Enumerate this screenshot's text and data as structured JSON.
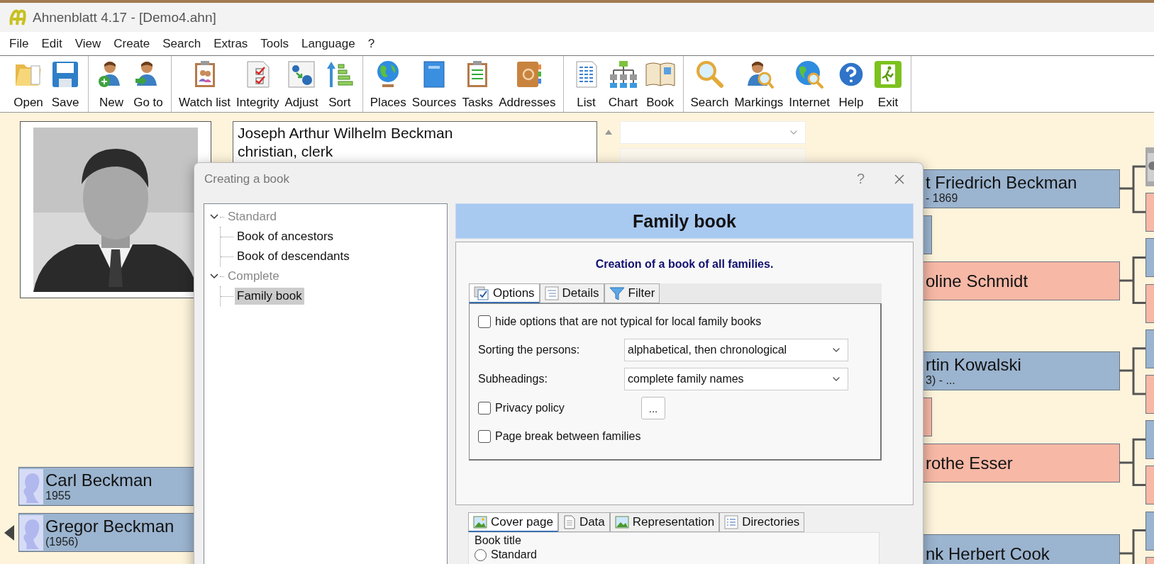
{
  "window": {
    "title": "Ahnenblatt 4.17 - [Demo4.ahn]"
  },
  "menu": [
    "File",
    "Edit",
    "View",
    "Create",
    "Search",
    "Extras",
    "Tools",
    "Language",
    "?"
  ],
  "toolbar": [
    [
      {
        "label": "Open"
      },
      {
        "label": "Save"
      }
    ],
    [
      {
        "label": "New"
      },
      {
        "label": "Go to"
      }
    ],
    [
      {
        "label": "Watch list"
      },
      {
        "label": "Integrity"
      },
      {
        "label": "Adjust"
      },
      {
        "label": "Sort"
      }
    ],
    [
      {
        "label": "Places"
      },
      {
        "label": "Sources"
      },
      {
        "label": "Tasks"
      },
      {
        "label": "Addresses"
      }
    ],
    [
      {
        "label": "List"
      },
      {
        "label": "Chart"
      },
      {
        "label": "Book"
      }
    ],
    [
      {
        "label": "Search"
      },
      {
        "label": "Markings"
      },
      {
        "label": "Internet"
      },
      {
        "label": "Help"
      },
      {
        "label": "Exit"
      }
    ]
  ],
  "person": {
    "name": "Joseph Arthur Wilhelm Beckman",
    "occupation": "christian, clerk"
  },
  "descendants": [
    {
      "name": "Carl Beckman",
      "dates": "1955"
    },
    {
      "name": "Gregor Beckman",
      "dates": "(1956)"
    }
  ],
  "chart_nodes": [
    {
      "name": "t Friedrich Beckman",
      "dates": "- 1869",
      "color": "#9bb4cf"
    },
    {
      "color": "#9bb4cf"
    },
    {
      "name": "oline Schmidt",
      "color": "#f7b8a6"
    },
    {
      "name": "rtin Kowalski",
      "dates": "3) - ...",
      "color": "#9bb4cf"
    },
    {
      "color": "#f7b8a6"
    },
    {
      "name": "rothe Esser",
      "color": "#f7b8a6"
    },
    {
      "name": "nk Herbert Cook",
      "color": "#9bb4cf"
    }
  ],
  "next_generation": [
    {
      "kind": "picture"
    },
    {
      "kind": "box",
      "color": "#f7b8a6"
    },
    {
      "kind": "box",
      "color": "#9bb4cf"
    },
    {
      "kind": "box",
      "color": "#f7b8a6"
    },
    {
      "kind": "box",
      "color": "#9bb4cf"
    },
    {
      "kind": "box",
      "color": "#f7b8a6"
    },
    {
      "kind": "box",
      "color": "#9bb4cf"
    },
    {
      "kind": "box",
      "color": "#f7b8a6"
    },
    {
      "kind": "box",
      "color": "#9bb4cf"
    },
    {
      "kind": "box",
      "color": "#f7b8a6"
    }
  ],
  "dialog": {
    "title": "Creating a book",
    "help": "?",
    "tree": [
      {
        "label": "Standard",
        "disabled": true,
        "expanded": true,
        "selected": false,
        "children": [
          {
            "label": "Book of ancestors",
            "disabled": false,
            "selected": false
          },
          {
            "label": "Book of descendants",
            "disabled": false,
            "selected": false
          }
        ]
      },
      {
        "label": "Complete",
        "disabled": true,
        "expanded": true,
        "selected": false,
        "children": [
          {
            "label": "Family book",
            "disabled": false,
            "selected": true
          }
        ]
      }
    ],
    "heading": "Family book",
    "description": "Creation of a book of all families.",
    "option_tabs": [
      {
        "label": "Options",
        "selected": true
      },
      {
        "label": "Details",
        "selected": false
      },
      {
        "label": "Filter",
        "selected": false
      }
    ],
    "options": [
      {
        "kind": "checkbox",
        "label": "hide options that are not typical for local family books",
        "checked": false
      },
      {
        "kind": "select",
        "label": "Sorting the persons:",
        "value": "alphabetical, then chronological"
      },
      {
        "kind": "select",
        "label": "Subheadings:",
        "value": "complete family names"
      },
      {
        "kind": "checkbox_button",
        "label": "Privacy policy",
        "checked": false,
        "button": "..."
      },
      {
        "kind": "checkbox",
        "label": "Page break between families",
        "checked": false
      }
    ],
    "section_tabs": [
      {
        "label": "Cover page",
        "selected": true
      },
      {
        "label": "Data",
        "selected": false
      },
      {
        "label": "Representation",
        "selected": false
      },
      {
        "label": "Directories",
        "selected": false
      }
    ],
    "book_title": {
      "legend": "Book title",
      "options": [
        {
          "label": "Standard",
          "selected": false
        }
      ]
    }
  }
}
